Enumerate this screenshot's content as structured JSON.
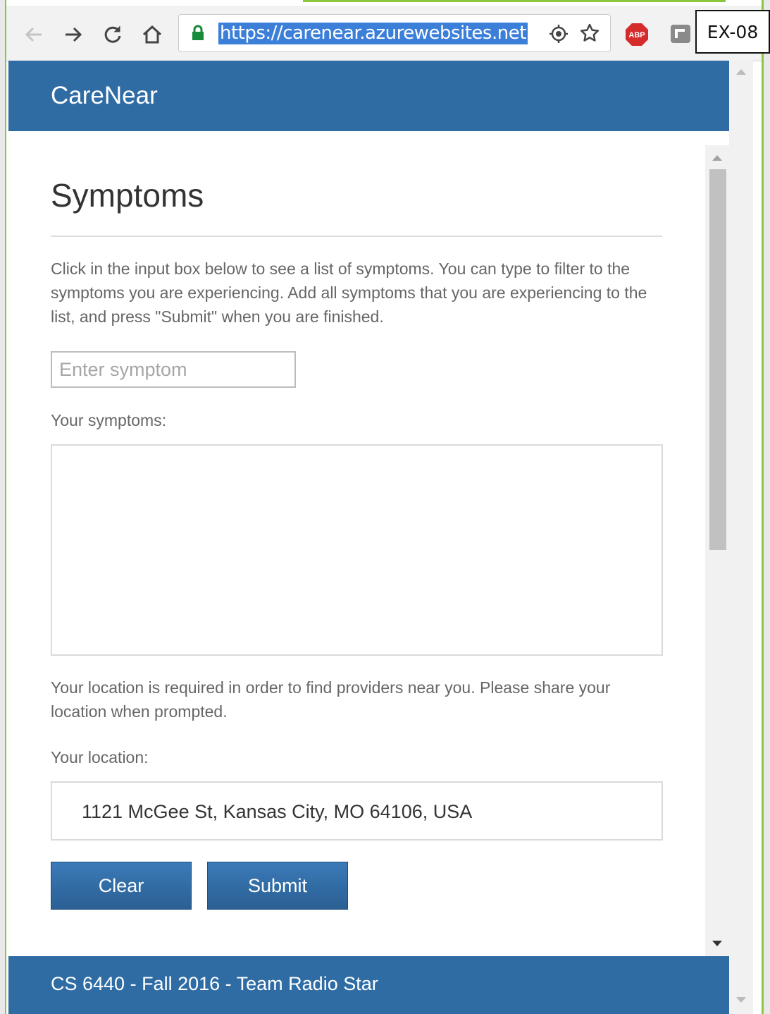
{
  "browser": {
    "url": "https://carenear.azurewebsites.net",
    "label_tag": "EX-08",
    "abp_badge": "ABP"
  },
  "header": {
    "brand": "CareNear"
  },
  "page": {
    "title": "Symptoms",
    "instructions": "Click in the input box below to see a list of symptoms. You can type to filter to the symptoms you are experiencing. Add all symptoms that you are experiencing to the list, and press \"Submit\" when you are finished.",
    "symptom_placeholder": "Enter symptom",
    "symptoms_label": "Your symptoms:",
    "location_note": "Your location is required in order to find providers near you. Please share your location when prompted.",
    "location_label": "Your location:",
    "location_value": "1121 McGee St, Kansas City, MO 64106, USA",
    "clear_label": "Clear",
    "submit_label": "Submit"
  },
  "footer": {
    "text": "CS 6440 - Fall 2016 - Team Radio Star"
  },
  "colors": {
    "brand_blue": "#2f6ca4",
    "window_accent": "#8cc63f",
    "url_highlight": "#3b7fd9"
  }
}
